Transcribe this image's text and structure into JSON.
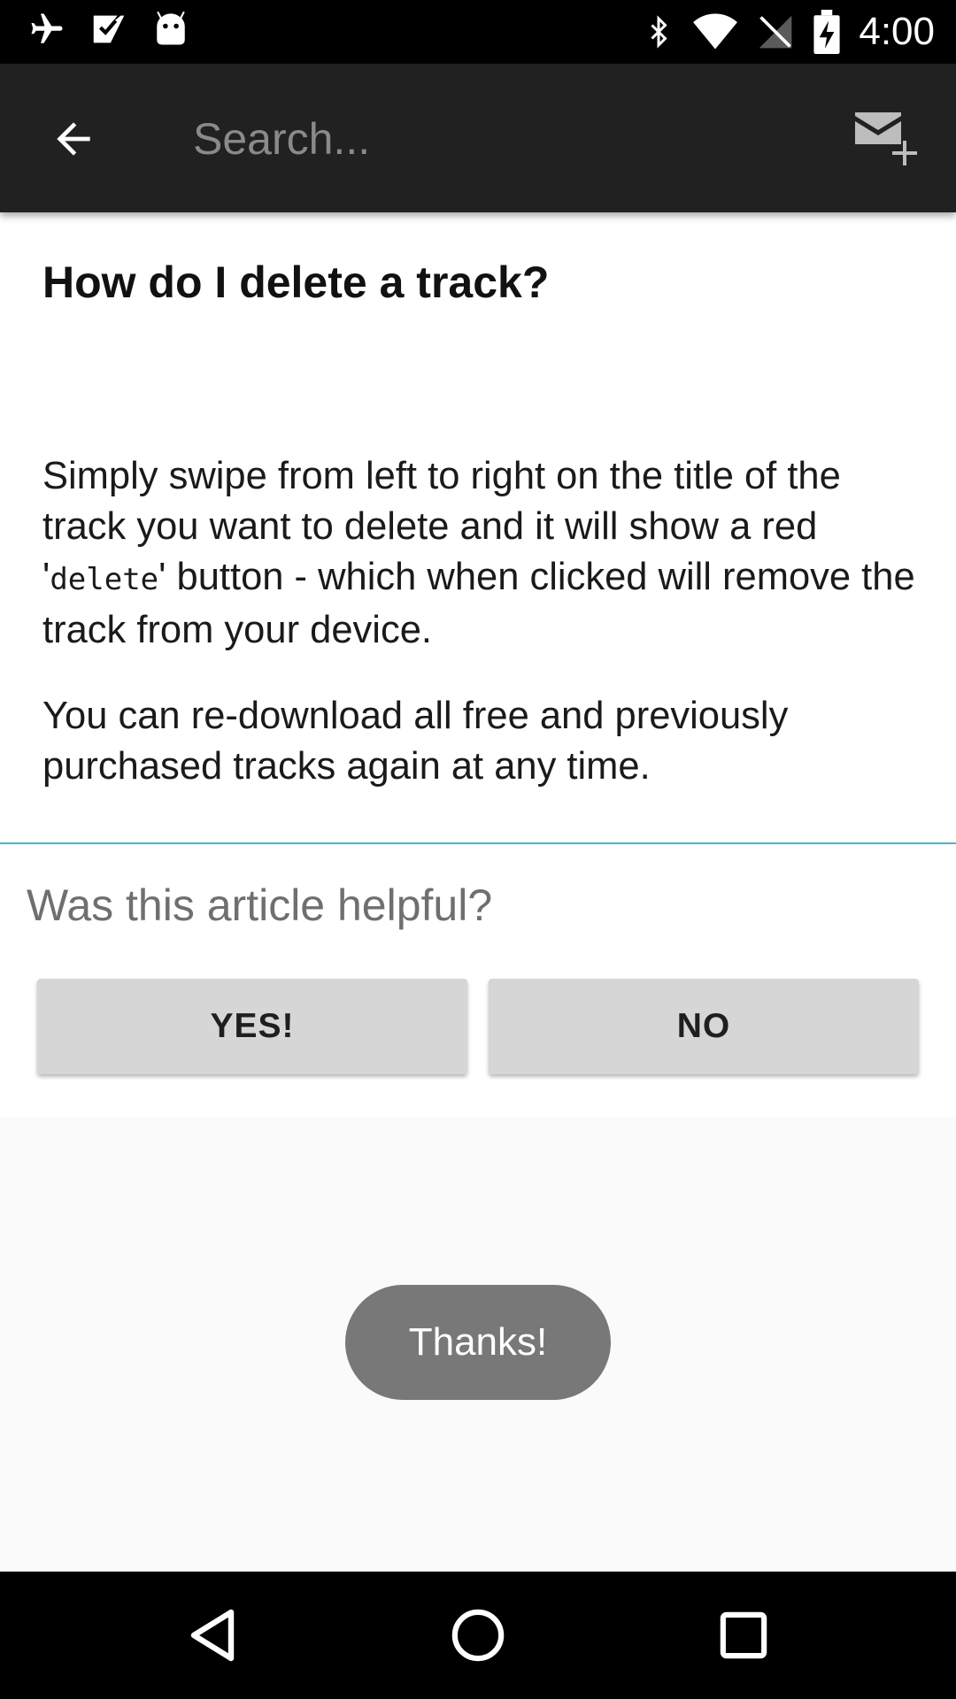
{
  "status_bar": {
    "time": "4:00",
    "left_icons": [
      "airplane-mode-icon",
      "download-check-icon",
      "android-debug-icon"
    ],
    "right_icons": [
      "bluetooth-icon",
      "wifi-icon",
      "no-signal-icon",
      "battery-charging-icon"
    ]
  },
  "toolbar": {
    "back_icon": "arrow-back-icon",
    "search_placeholder": "Search...",
    "search_value": "",
    "action_icon": "new-message-icon"
  },
  "article": {
    "title": "How do I delete a track?",
    "para1_before": "Simply swipe from left to right on the title of the track you want to delete and it will show a red '",
    "para1_code": "delete",
    "para1_after": "' button - which when clicked will remove the track from your device.",
    "para2": "You can re-download all free and previously purchased tracks again at any time."
  },
  "feedback": {
    "question": "Was this article helpful?",
    "yes_label": "YES!",
    "no_label": "NO",
    "divider_color": "#47b4c6"
  },
  "toast": {
    "text": "Thanks!"
  },
  "nav_bar": {
    "icons": [
      "nav-back-icon",
      "nav-home-icon",
      "nav-recents-icon"
    ]
  }
}
